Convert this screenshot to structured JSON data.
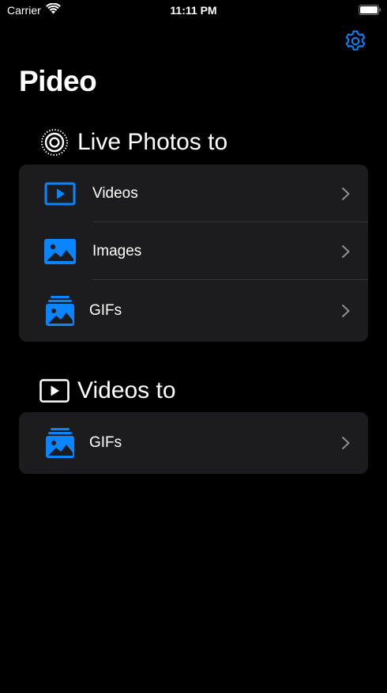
{
  "status_bar": {
    "carrier": "Carrier",
    "time": "11:11 PM"
  },
  "header": {
    "title": "Pideo",
    "settings_icon": "gear-icon"
  },
  "sections": [
    {
      "title": "Live Photos to",
      "icon": "live-photo-icon",
      "items": [
        {
          "label": "Videos",
          "icon": "video-play-icon"
        },
        {
          "label": "Images",
          "icon": "image-icon"
        },
        {
          "label": "GIFs",
          "icon": "gif-stack-icon"
        }
      ]
    },
    {
      "title": "Videos to",
      "icon": "video-play-icon",
      "items": [
        {
          "label": "GIFs",
          "icon": "gif-stack-icon"
        }
      ]
    }
  ],
  "colors": {
    "accent": "#0a84ff",
    "background": "#000000",
    "card": "#1c1c1e",
    "separator": "#38383a",
    "chevron": "#8e8e93"
  }
}
